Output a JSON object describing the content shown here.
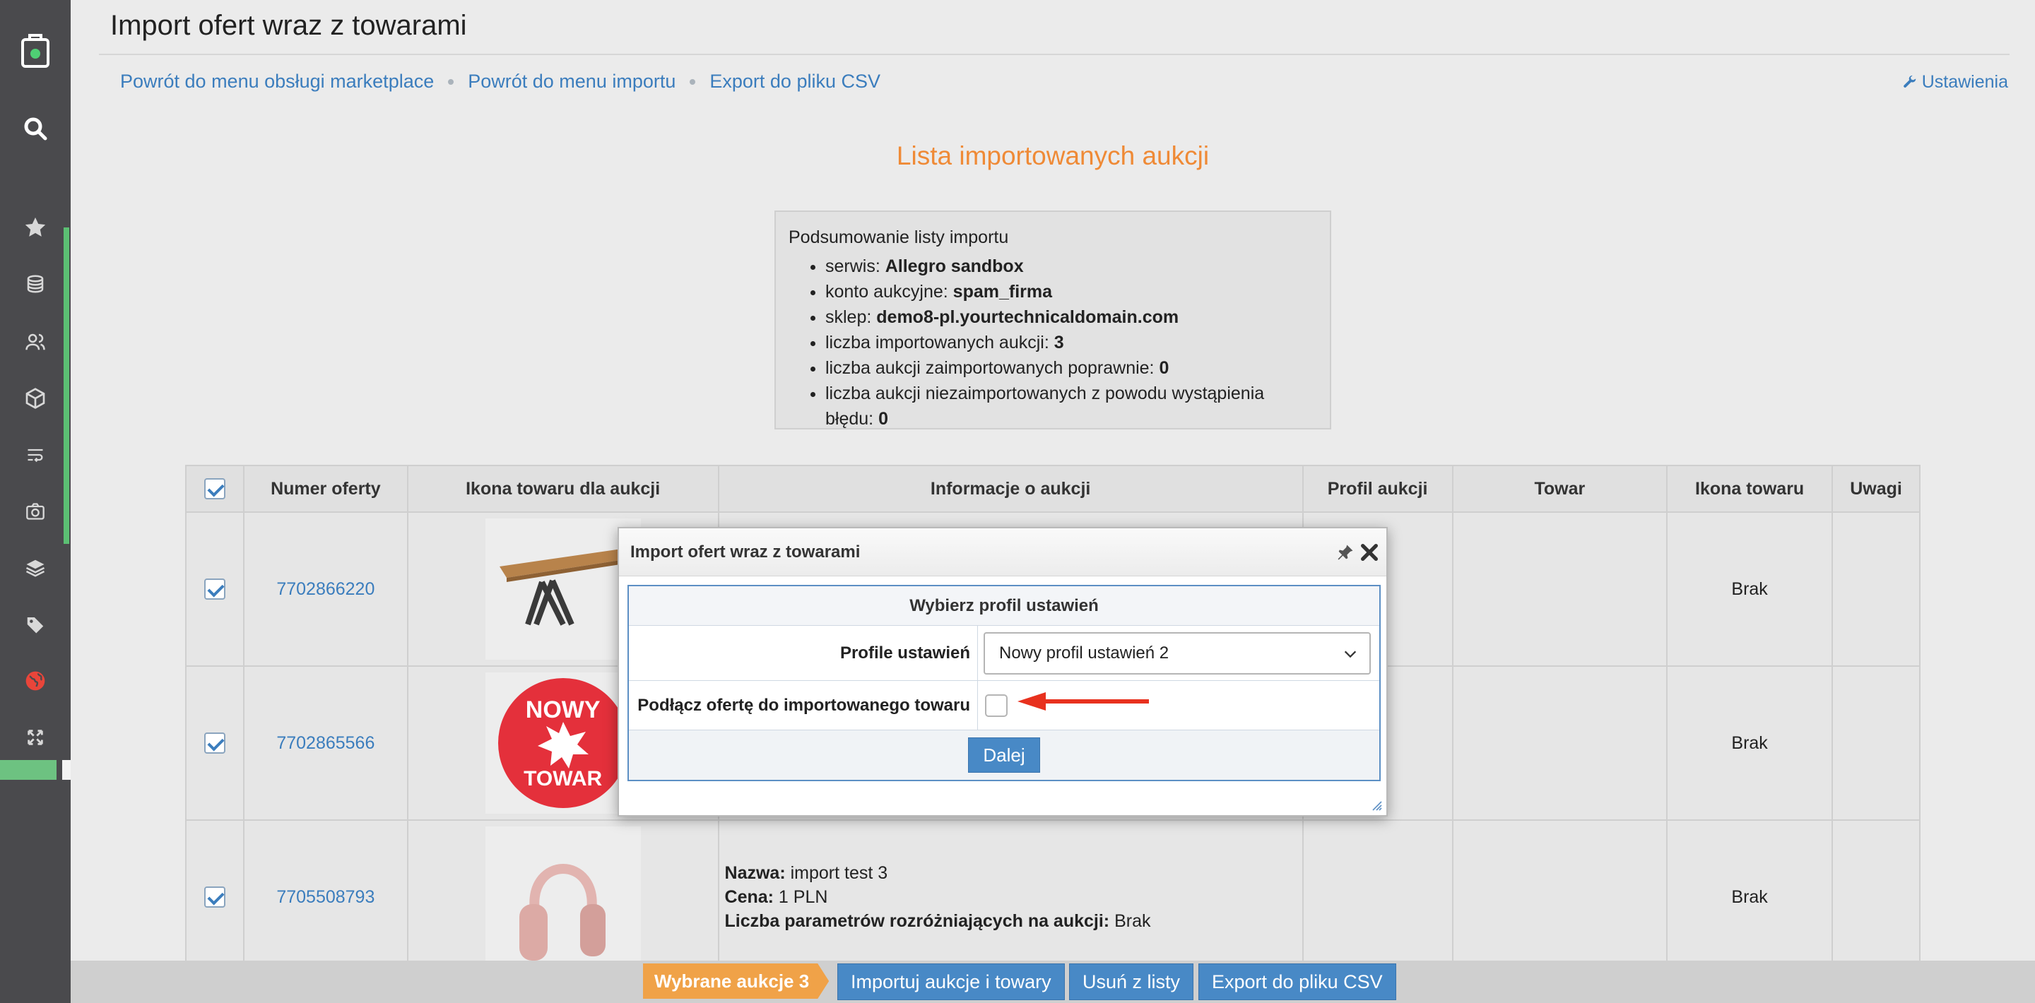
{
  "page": {
    "title": "Import ofert wraz z towarami"
  },
  "toplinks": {
    "marketplace": "Powrót do menu obsługi marketplace",
    "import_menu": "Powrót do menu importu",
    "export_csv": "Export do pliku CSV",
    "settings": "Ustawienia"
  },
  "list_title": "Lista importowanych aukcji",
  "summary": {
    "title": "Podsumowanie listy importu",
    "items": [
      {
        "label": "serwis: ",
        "value": "Allegro sandbox"
      },
      {
        "label": "konto aukcyjne: ",
        "value": "spam_firma"
      },
      {
        "label": "sklep: ",
        "value": "demo8-pl.yourtechnicaldomain.com"
      },
      {
        "label": "liczba importowanych aukcji: ",
        "value": "3"
      },
      {
        "label": "liczba aukcji zaimportowanych poprawnie: ",
        "value": "0"
      },
      {
        "label": "liczba aukcji niezaimportowanych z powodu wystąpienia błędu: ",
        "value": "0"
      }
    ]
  },
  "table": {
    "headers": [
      "Numer oferty",
      "Ikona towaru dla aukcji",
      "Informacje o aukcji",
      "Profil aukcji",
      "Towar",
      "Ikona towaru",
      "Uwagi"
    ],
    "rows": [
      {
        "offer": "7702866220",
        "icon_status": "Brak"
      },
      {
        "offer": "7702865566",
        "icon_status": "Brak",
        "thumb_line1": "NOWY",
        "thumb_line2": "TOWAR"
      },
      {
        "offer": "7705508793",
        "icon_status": "Brak",
        "info": {
          "name_label": "Nazwa:",
          "name": " import test 3",
          "price_label": "Cena:",
          "price": " 1 PLN",
          "params_label": "Liczba parametrów rozróżniających na aukcji:",
          "params": " Brak"
        }
      }
    ]
  },
  "modal": {
    "title": "Import ofert wraz z towarami",
    "section": "Wybierz profil ustawień",
    "profile_label": "Profile ustawień",
    "profile_value": "Nowy profil ustawień 2",
    "connect_label": "Podłącz ofertę do importowanego towaru",
    "next": "Dalej"
  },
  "bottombar": {
    "selected": "Wybrane aukcje 3",
    "import": "Importuj aukcje i towary",
    "remove": "Usuń z listy",
    "export": "Export do pliku CSV"
  },
  "colors": {
    "accent_blue": "#3b7dbd",
    "orange": "#ef8a36",
    "sidebar": "#4a4a4d",
    "arrow_red": "#e8311e"
  }
}
